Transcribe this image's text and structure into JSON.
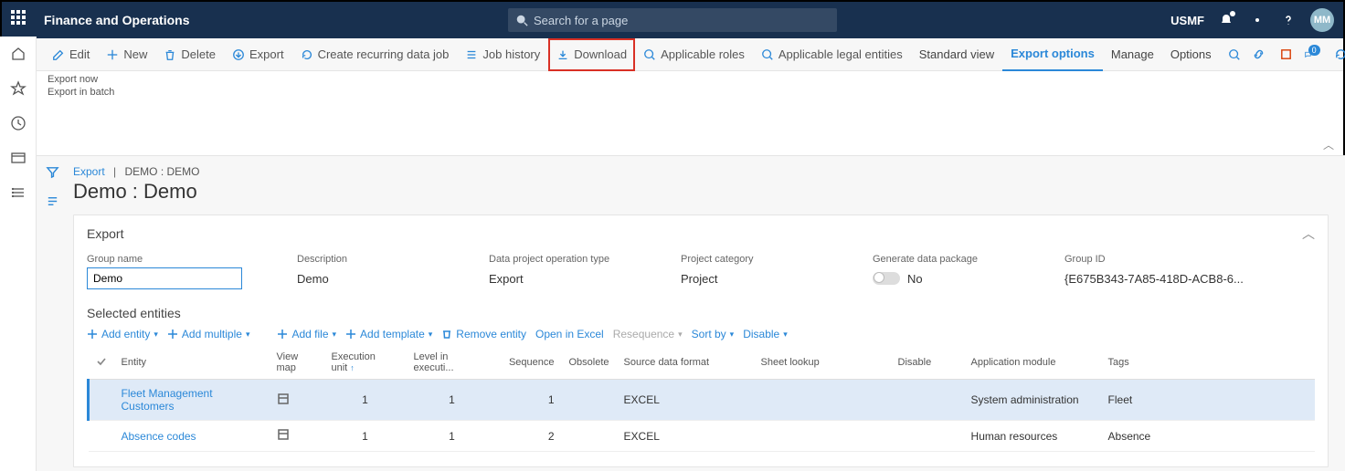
{
  "topbar": {
    "brand": "Finance and Operations",
    "search_placeholder": "Search for a page",
    "company": "USMF",
    "avatar": "MM"
  },
  "actionbar": {
    "edit": "Edit",
    "new": "New",
    "delete": "Delete",
    "export": "Export",
    "recurring": "Create recurring data job",
    "jobhistory": "Job history",
    "download": "Download",
    "roles": "Applicable roles",
    "legal": "Applicable legal entities",
    "standard": "Standard view",
    "exportopts": "Export options",
    "manage": "Manage",
    "options": "Options",
    "msg_badge": "0"
  },
  "subbar": {
    "now": "Export now",
    "batch": "Export in batch"
  },
  "crumb": {
    "root": "Export",
    "current": "DEMO : DEMO"
  },
  "title": "Demo : Demo",
  "panel": {
    "header": "Export",
    "group_label": "Group name",
    "group_value": "Demo",
    "desc_label": "Description",
    "desc_value": "Demo",
    "op_label": "Data project operation type",
    "op_value": "Export",
    "cat_label": "Project category",
    "cat_value": "Project",
    "gen_label": "Generate data package",
    "gen_value": "No",
    "id_label": "Group ID",
    "id_value": "{E675B343-7A85-418D-ACB8-6..."
  },
  "entities": {
    "header": "Selected entities",
    "toolbar": {
      "add_entity": "Add entity",
      "add_multiple": "Add multiple",
      "add_file": "Add file",
      "add_template": "Add template",
      "remove": "Remove entity",
      "open_excel": "Open in Excel",
      "resequence": "Resequence",
      "sort": "Sort by",
      "disable": "Disable"
    },
    "columns": {
      "entity": "Entity",
      "viewmap": "View map",
      "execunit": "Execution unit",
      "level": "Level in executi...",
      "sequence": "Sequence",
      "obsolete": "Obsolete",
      "source": "Source data format",
      "sheet": "Sheet lookup",
      "disable": "Disable",
      "appmod": "Application module",
      "tags": "Tags"
    },
    "rows": [
      {
        "entity": "Fleet Management Customers",
        "execunit": "1",
        "level": "1",
        "sequence": "1",
        "source": "EXCEL",
        "appmod": "System administration",
        "tags": "Fleet",
        "selected": true
      },
      {
        "entity": "Absence codes",
        "execunit": "1",
        "level": "1",
        "sequence": "2",
        "source": "EXCEL",
        "appmod": "Human resources",
        "tags": "Absence",
        "selected": false
      }
    ]
  }
}
